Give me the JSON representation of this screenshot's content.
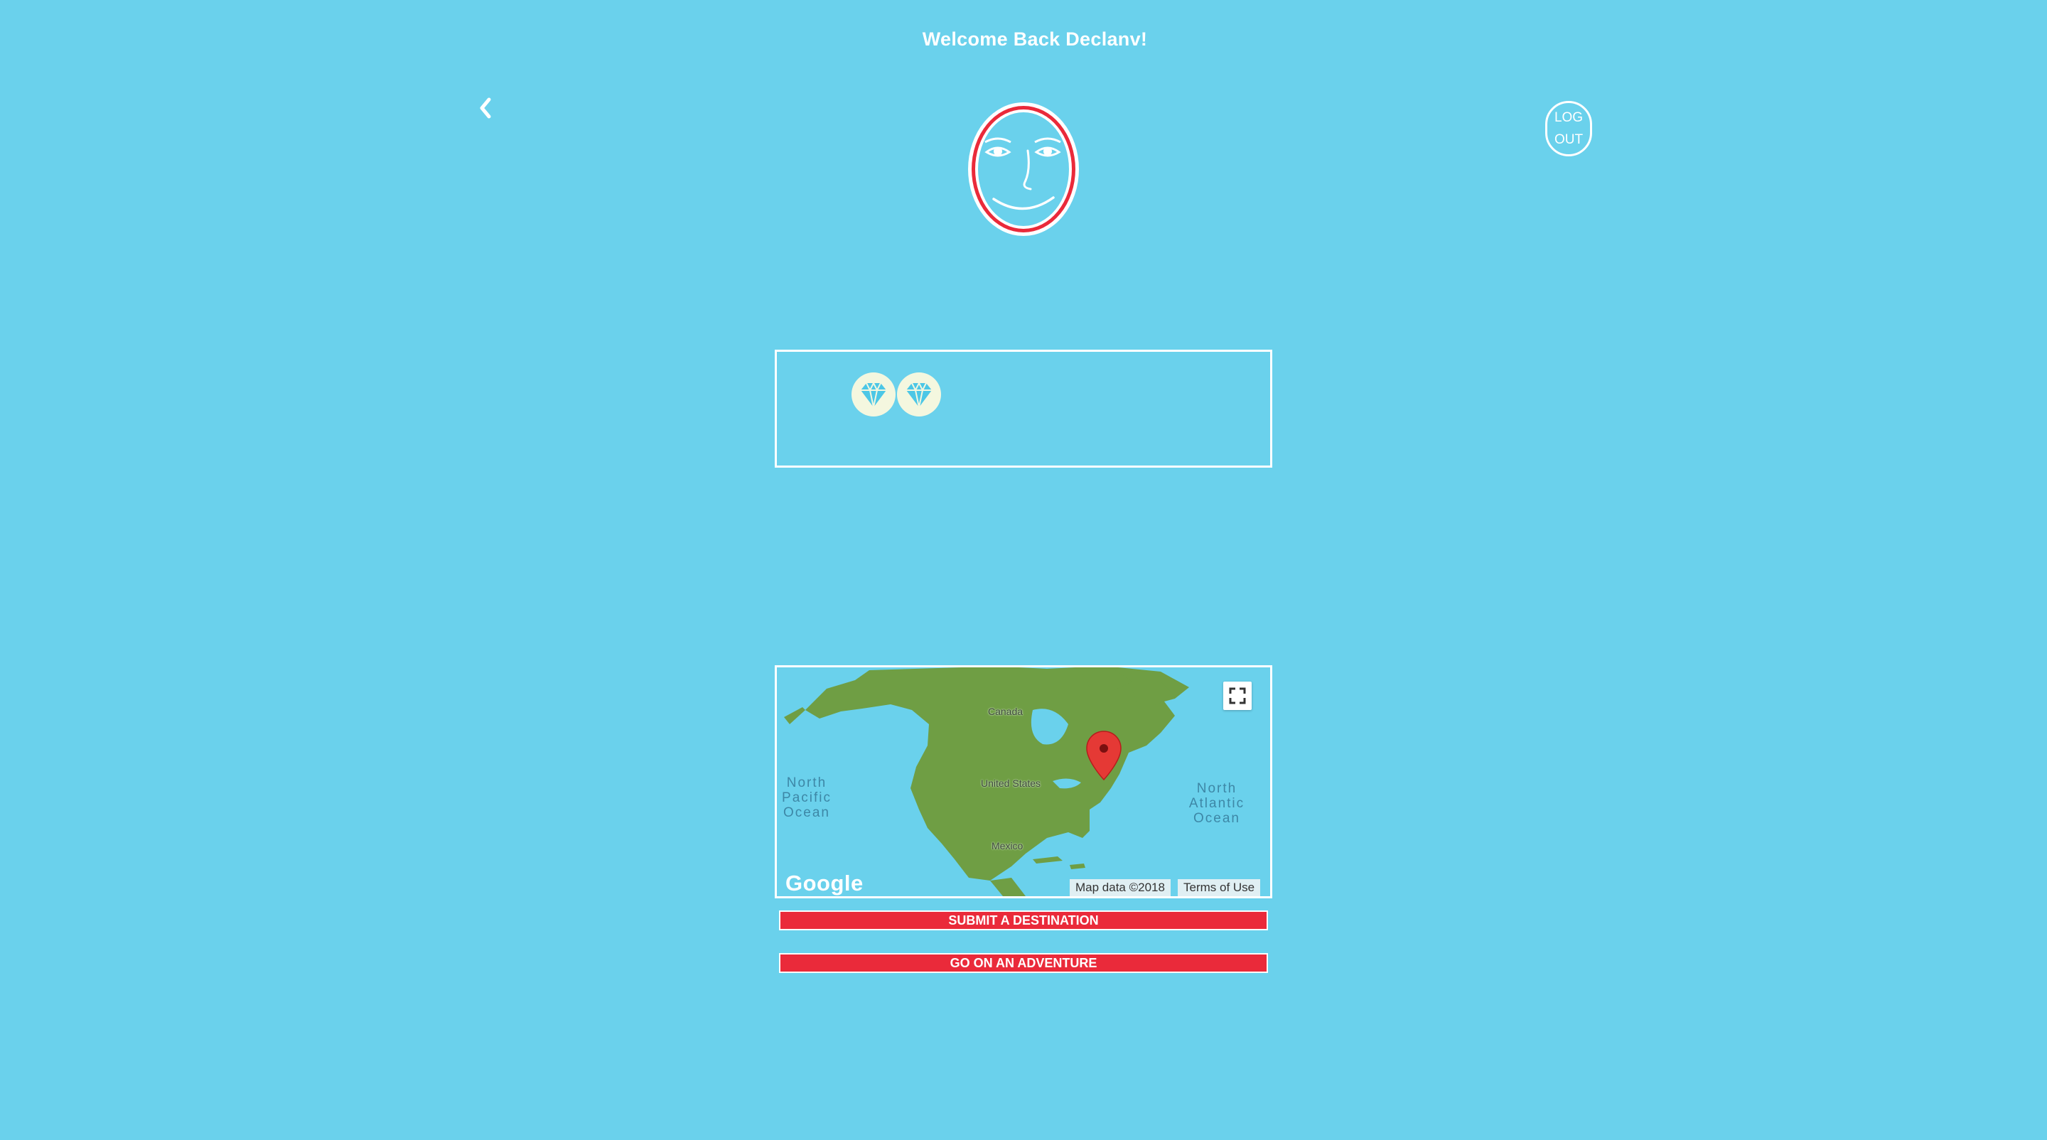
{
  "header": {
    "title": "Welcome Back Declanv!"
  },
  "nav": {
    "back_icon": "chevron-left-icon",
    "logout_line1": "LOG",
    "logout_line2": "OUT"
  },
  "profile": {
    "avatar_icon": "smiling-face-avatar-icon"
  },
  "gems": {
    "count": 2,
    "badge_icon": "diamond-icon"
  },
  "map": {
    "ocean_labels": {
      "north_pacific": "North Pacific Ocean",
      "north_atlantic": "North Atlantic Ocean"
    },
    "country_labels": {
      "canada": "Canada",
      "united_states": "United States",
      "mexico": "Mexico"
    },
    "logo": "Google",
    "map_data": "Map data ©2018",
    "terms": "Terms of Use",
    "fullscreen_icon": "fullscreen-icon",
    "marker_icon": "map-pin-icon"
  },
  "actions": {
    "submit_destination": "SUBMIT A DESTINATION",
    "go_adventure": "GO ON AN ADVENTURE"
  },
  "colors": {
    "background": "#6ad1ec",
    "accent_red": "#ea2a3a",
    "land_green": "#6f9e44",
    "gem_cyan": "#4cc7e6"
  }
}
